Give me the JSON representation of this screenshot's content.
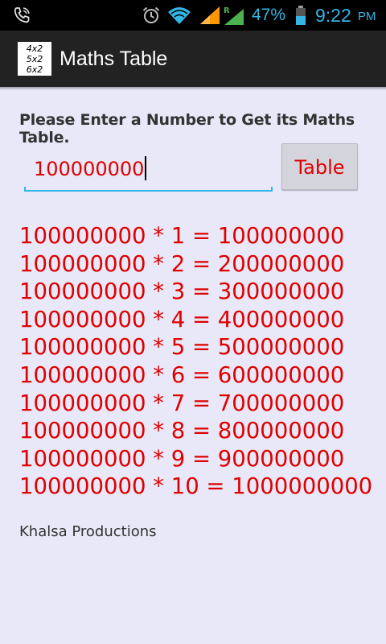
{
  "status_bar": {
    "battery": "47%",
    "time": "9:22",
    "ampm": "PM",
    "icons": [
      "phone-icon",
      "alarm-icon",
      "wifi-icon",
      "signal-icon",
      "roaming-signal-icon",
      "battery-icon"
    ],
    "roaming_label": "R",
    "accent_color": "#33b5e5"
  },
  "app_bar": {
    "title": "Maths Table",
    "icon_lines": [
      "4x2",
      "5x2",
      "6x2"
    ]
  },
  "prompt": "Please Enter a Number to Get its Maths Table.",
  "input": {
    "value": "100000000"
  },
  "table_button": {
    "label": "Table"
  },
  "table_rows": [
    "100000000 * 1 = 100000000",
    "100000000 * 2 = 200000000",
    "100000000 * 3 = 300000000",
    "100000000 * 4 = 400000000",
    "100000000 * 5 = 500000000",
    "100000000 * 6 = 600000000",
    "100000000 * 7 = 700000000",
    "100000000 * 8 = 800000000",
    "100000000 * 9 = 900000000",
    "100000000 * 10 = 1000000000"
  ],
  "footer": "Khalsa Productions",
  "colors": {
    "accent": "#e00000",
    "background": "#e8e8f8",
    "actionbar": "#222222"
  }
}
